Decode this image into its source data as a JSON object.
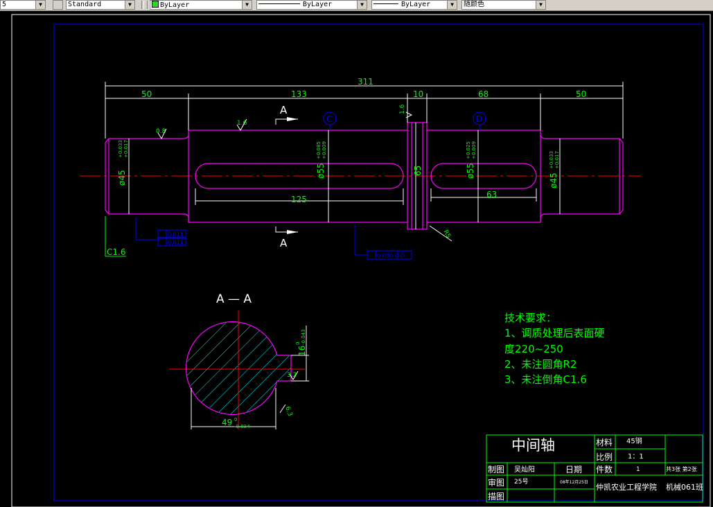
{
  "toolbar": {
    "first_value": "5",
    "text_style": "Standard",
    "layer": "ByLayer",
    "linetype": "ByLayer",
    "lineweight": "ByLayer",
    "plot_style": "随颜色"
  },
  "drawing": {
    "dims": {
      "overall": "311",
      "d50a": "50",
      "d133": "133",
      "d10": "10",
      "d68": "68",
      "d50b": "50",
      "d125": "125",
      "d63": "63",
      "d65": "65",
      "phi45a": "ø45",
      "phi45a_tol_up": "+0.033",
      "phi45a_tol_dn": "+0.017",
      "phi55a": "ø55",
      "phi55a_tol_up": "+0.085",
      "phi55a_tol_dn": "+0.009",
      "phi55b": "ø55",
      "phi55b_tol_up": "+0.025",
      "phi55b_tol_dn": "+0.009",
      "phi45b": "ø45",
      "phi45b_tol_up": "+0.033",
      "phi45b_tol_dn": "+0.017",
      "chamfer": "C1.6",
      "rough_08": "0.8",
      "rough_16a": "1.6",
      "rough_16b": "1.6",
      "rough_32": "3.2",
      "rough_63": "6.3",
      "rough_r5": "R5",
      "tol_box1": "0.011",
      "tol_box2": "0.011",
      "tol_box3": "0.030 C-D",
      "section_mark": "A",
      "datum_c": "C",
      "datum_d": "D"
    },
    "section": {
      "title": "A — A",
      "d49": "49",
      "d49_tol_up": "0",
      "d49_tol_dn": "-0.034",
      "d16": "16",
      "d16_tol_up": "0",
      "d16_tol_dn": "-0.043",
      "rough_32": "3.2",
      "rough_63": "6.3"
    },
    "notes": {
      "title": "技术要求：",
      "line1": "1、调质处理后表面硬",
      "line2": "度220~250",
      "line3": "2、未注圆角R2",
      "line4": "3、未注倒角C1.6"
    },
    "title_block": {
      "part_name": "中间轴",
      "material_label": "材料",
      "material_value": "45钢",
      "scale_label": "比例",
      "scale_value": "1：1",
      "qty_label": "件数",
      "qty_value": "1",
      "sheet_info": "共3张 第2张",
      "drawn_label": "制图",
      "drawn_value": "吴灿阳",
      "date_label": "日期",
      "checked_label": "审图",
      "checked_value": "25号",
      "date_value": "08年12月25日",
      "traced_label": "描图",
      "school": "仲凯农业工程学院",
      "class_name": "机械061班"
    }
  },
  "colors": {
    "background": "#000000",
    "outline": "#ff00ff",
    "dimension": "#00ff00",
    "centerline": "#ff0000",
    "frame": "#0000ff",
    "hatch": "#00ffff",
    "text": "#ffffff"
  }
}
